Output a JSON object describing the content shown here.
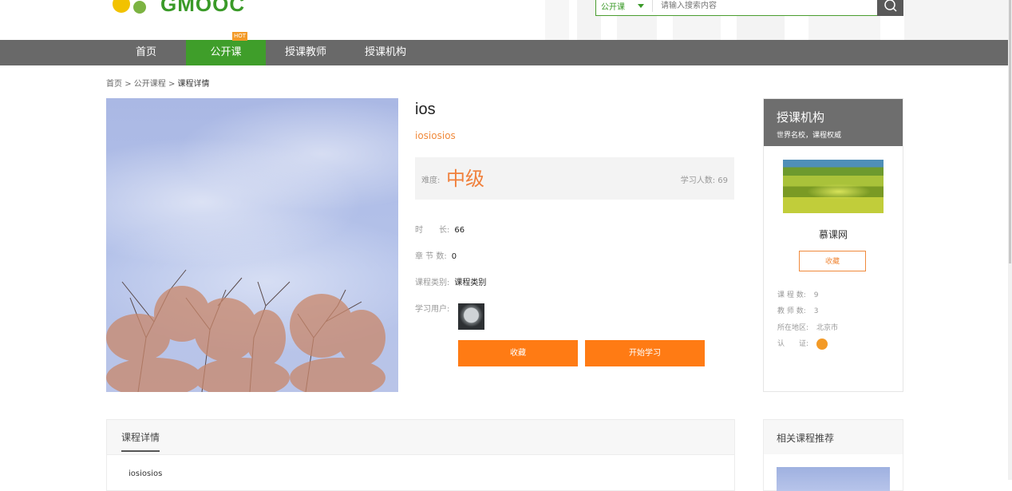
{
  "header": {
    "logo_text": "GMOOC",
    "search": {
      "category": "公开课",
      "placeholder": "请输入搜索内容"
    }
  },
  "nav": {
    "items": [
      {
        "label": "首页",
        "active": false
      },
      {
        "label": "公开课",
        "active": true,
        "badge": "HOT"
      },
      {
        "label": "授课教师",
        "active": false
      },
      {
        "label": "授课机构",
        "active": false
      }
    ]
  },
  "breadcrumb": {
    "home": "首页",
    "sep": ">",
    "section": "公开课程",
    "current": "课程详情"
  },
  "course": {
    "title": "ios",
    "subtitle": "iosiosios",
    "difficulty_label": "难度:",
    "difficulty_value": "中级",
    "students_label": "学习人数:",
    "students_value": "69",
    "duration_label": "时　　长:",
    "duration_value": "66",
    "chapters_label": "章 节 数:",
    "chapters_value": "0",
    "category_label": "课程类别:",
    "category_value": "课程类别",
    "users_label": "学习用户:",
    "favorite_button": "收藏",
    "start_button": "开始学习"
  },
  "org_panel": {
    "title": "授课机构",
    "slogan": "世界名校，课程权威",
    "name": "慕课网",
    "favorite_button": "收藏",
    "courses_label": "课 程 数:",
    "courses_value": "9",
    "teachers_label": "教 师 数:",
    "teachers_value": "3",
    "region_label": "所在地区:",
    "region_value": "北京市",
    "cert_label": "认　　证:"
  },
  "detail": {
    "tab": "课程详情",
    "body": "iosiosios"
  },
  "related": {
    "title": "相关课程推荐"
  },
  "colors": {
    "brand_green": "#3f9e2a",
    "accent_orange": "#ff7b14",
    "nav_gray": "#696969"
  }
}
